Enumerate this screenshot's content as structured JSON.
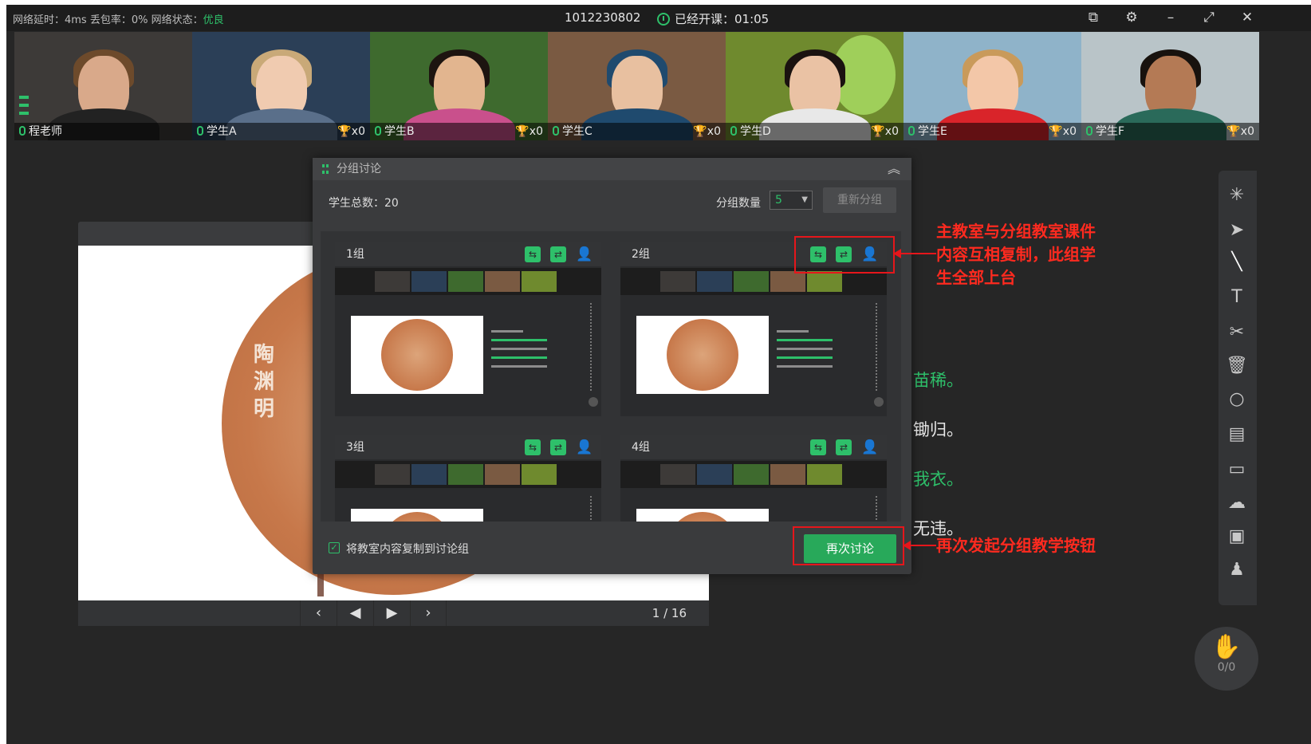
{
  "status": {
    "net_label": "网络延时：4ms 丢包率：0% 网络状态：",
    "net_state": "优良",
    "room_id": "1012230802",
    "timer": "已经开课：01:05"
  },
  "videos": [
    {
      "name": "程老师",
      "trophy": ""
    },
    {
      "name": "学生A",
      "trophy": "x0"
    },
    {
      "name": "学生B",
      "trophy": "x0"
    },
    {
      "name": "学生C",
      "trophy": "x0"
    },
    {
      "name": "学生D",
      "trophy": "x0"
    },
    {
      "name": "学生E",
      "trophy": "x0"
    },
    {
      "name": "学生F",
      "trophy": "x0"
    }
  ],
  "courseware": {
    "seal": "陶渊明",
    "page": "1 / 16"
  },
  "poem_fragments": [
    {
      "text": "苗稀。",
      "color": "#2ec06a"
    },
    {
      "text": "锄归。",
      "color": "#e8e8e8"
    },
    {
      "text": "我衣。",
      "color": "#2ec06a"
    },
    {
      "text": "无违。",
      "color": "#e8e8e8"
    }
  ],
  "dialog": {
    "title": "分组讨论",
    "total": "学生总数：20",
    "group_count_label": "分组数量",
    "group_count_value": "5",
    "regroup": "重新分组",
    "groups": [
      "1组",
      "2组",
      "3组",
      "4组"
    ],
    "copy_option": "将教室内容复制到讨论组",
    "copy_checked": true,
    "again_button": "再次讨论"
  },
  "hand": {
    "count": "0/0"
  },
  "annotations": {
    "note1": "主教室与分组教室课件内容互相复制，此组学生全部上台",
    "note2": "再次发起分组教学按钮"
  },
  "colors": {
    "accent": "#2ec06a",
    "annotation": "#e6161b"
  }
}
